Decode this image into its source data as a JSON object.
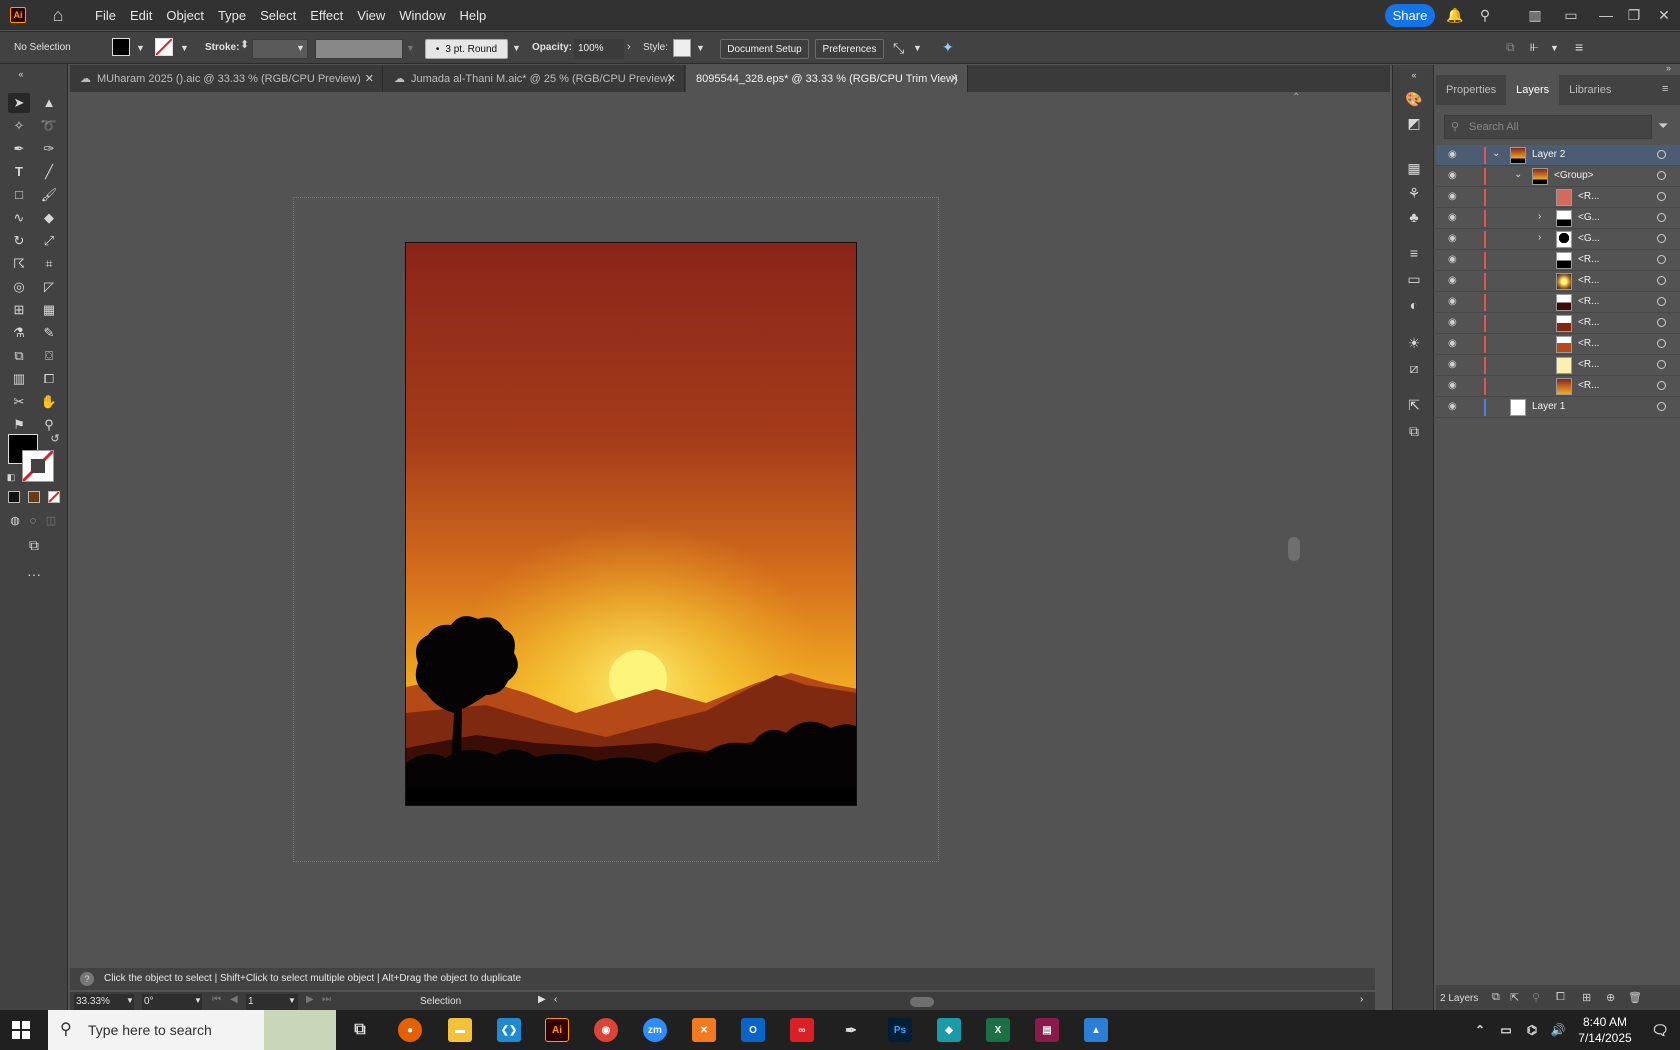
{
  "app": {
    "logo": "Ai",
    "share_label": "Share"
  },
  "menu": [
    "File",
    "Edit",
    "Object",
    "Type",
    "Select",
    "Effect",
    "View",
    "Window",
    "Help"
  ],
  "control_bar": {
    "selection_text": "No Selection",
    "stroke_label": "Stroke:",
    "brush_value": "3 pt. Round",
    "opacity_label": "Opacity:",
    "opacity_value": "100%",
    "style_label": "Style:",
    "doc_setup_label": "Document Setup",
    "preferences_label": "Preferences"
  },
  "tabs": [
    {
      "label": "MUharam 2025 ().aic @ 33.33 % (RGB/CPU Preview)"
    },
    {
      "label": "Jumada al-Thani M.aic* @ 25 % (RGB/CPU Preview)"
    },
    {
      "label": "8095544_328.eps* @ 33.33 % (RGB/CPU Trim View)"
    }
  ],
  "panel": {
    "tabs": [
      "Properties",
      "Layers",
      "Libraries"
    ],
    "search_placeholder": "Search All",
    "footer_count": "2 Layers",
    "layers": [
      {
        "name": "Layer 2",
        "bar": "#e0564e"
      },
      {
        "name": "<Group>",
        "bar": "#e0564e"
      },
      {
        "name": "<R...",
        "bar": "#e0564e"
      },
      {
        "name": "<G...",
        "bar": "#e0564e"
      },
      {
        "name": "<G...",
        "bar": "#e0564e"
      },
      {
        "name": "<R...",
        "bar": "#e0564e"
      },
      {
        "name": "<R...",
        "bar": "#e0564e"
      },
      {
        "name": "<R...",
        "bar": "#e0564e"
      },
      {
        "name": "<R...",
        "bar": "#e0564e"
      },
      {
        "name": "<R...",
        "bar": "#e0564e"
      },
      {
        "name": "<R...",
        "bar": "#e0564e"
      },
      {
        "name": "<R...",
        "bar": "#e0564e"
      },
      {
        "name": "Layer 1",
        "bar": "#4f7fe0"
      }
    ]
  },
  "status": {
    "hint": "Click the object to select  |  Shift+Click to select multiple object  |  Alt+Drag the object to duplicate",
    "zoom": "33.33%",
    "rotation": "0°",
    "artboard": "1",
    "tool": "Selection"
  },
  "taskbar": {
    "search_placeholder": "Type here to search",
    "time": "8:40 AM",
    "date": "7/14/2025"
  }
}
